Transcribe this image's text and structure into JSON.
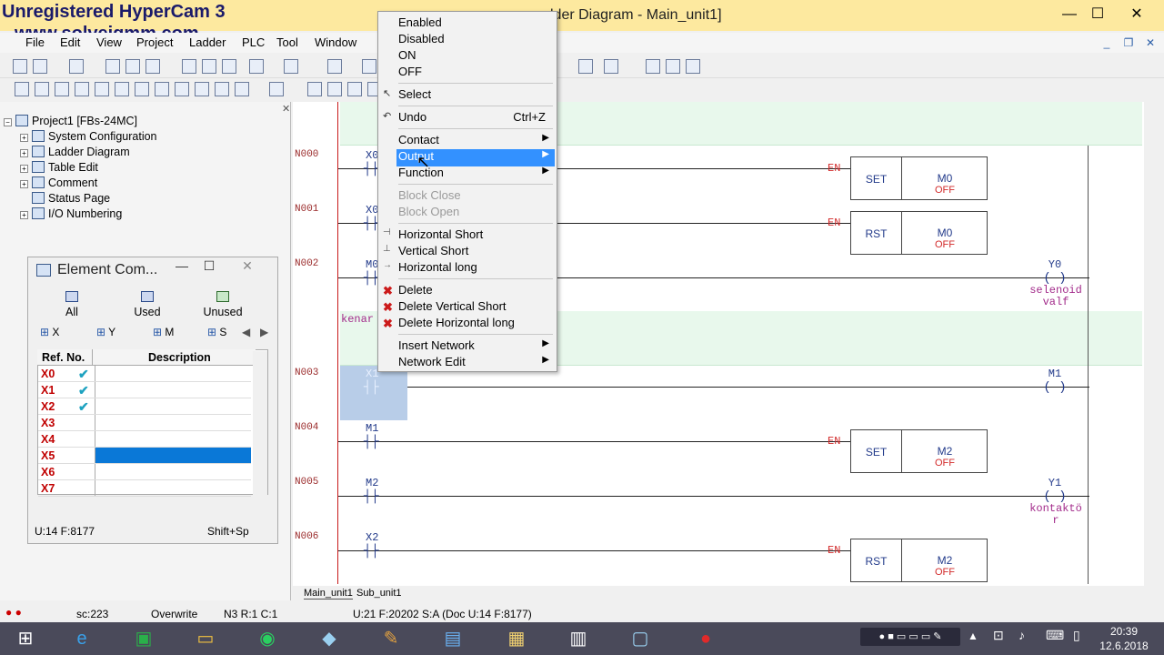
{
  "watermark": {
    "line1": "Unregistered HyperCam 3",
    "line2": "www.solveigmm.com"
  },
  "window": {
    "title": "lder Diagram - Main_unit1]"
  },
  "menu": [
    "File",
    "Edit",
    "View",
    "Project",
    "Ladder",
    "PLC",
    "Tool",
    "Window"
  ],
  "project_tree": {
    "root": "Project1 [FBs-24MC]",
    "items": [
      "System Configuration",
      "Ladder Diagram",
      "Table Edit",
      "Comment",
      "Status Page",
      "I/O Numbering"
    ]
  },
  "element_window": {
    "title": "Element Com...",
    "tabs": [
      "All",
      "Used",
      "Unused"
    ],
    "filters": [
      "X",
      "Y",
      "M",
      "S"
    ],
    "columns": [
      "Ref. No.",
      "Description"
    ],
    "rows": [
      {
        "ref": "X0",
        "check": "✔"
      },
      {
        "ref": "X1",
        "check": "✔"
      },
      {
        "ref": "X2",
        "check": "✔"
      },
      {
        "ref": "X3",
        "check": ""
      },
      {
        "ref": "X4",
        "check": ""
      },
      {
        "ref": "X5",
        "check": ""
      },
      {
        "ref": "X6",
        "check": ""
      },
      {
        "ref": "X7",
        "check": ""
      }
    ],
    "status_left": "U:14 F:8177",
    "status_right": "Shift+Sp"
  },
  "ladder": {
    "networks": [
      "N000",
      "N001",
      "N002",
      "N003",
      "N004",
      "N005",
      "N006"
    ],
    "contacts": [
      "X0",
      "X0",
      "M0",
      "X1",
      "M1",
      "M2",
      "X2"
    ],
    "comment_label": "kenar",
    "en_label": "EN",
    "blocks": [
      {
        "op": "SET",
        "target": "M0",
        "state": "OFF"
      },
      {
        "op": "RST",
        "target": "M0",
        "state": "OFF"
      },
      {
        "op": "SET",
        "target": "M2",
        "state": "OFF"
      },
      {
        "op": "RST",
        "target": "M2",
        "state": "OFF"
      }
    ],
    "coils": [
      {
        "name": "Y0",
        "comment1": "selenoid",
        "comment2": "valf"
      },
      {
        "name": "M1"
      },
      {
        "name": "Y1",
        "comment1": "kontaktö",
        "comment2": "r"
      }
    ],
    "tabs": [
      "Main_unit1",
      "Sub_unit1"
    ]
  },
  "context_menu": {
    "state_items": [
      "Enabled",
      "Disabled",
      "ON",
      "OFF"
    ],
    "select": "Select",
    "undo": "Undo",
    "undo_shortcut": "Ctrl+Z",
    "contact": "Contact",
    "output": "Output",
    "function": "Function",
    "block_close": "Block Close",
    "block_open": "Block Open",
    "h_short": "Horizontal Short",
    "v_short": "Vertical Short",
    "h_long": "Horizontal long",
    "delete": "Delete",
    "delete_v_short": "Delete Vertical Short",
    "delete_h_long": "Delete Horizontal long",
    "insert_network": "Insert Network",
    "network_edit": "Network Edit"
  },
  "statusbar": {
    "s1": "sc:223",
    "s2": "Overwrite",
    "s3": "N3 R:1 C:1",
    "s4": "U:21 F:20202 S:A (Doc U:14 F:8177)"
  },
  "taskbar": {
    "time": "20:39",
    "date": "12.6.2018"
  },
  "colors": {
    "selection": "#3391ff",
    "title_bg": "#fde99f",
    "highlight_net": "#e8f8ec"
  }
}
